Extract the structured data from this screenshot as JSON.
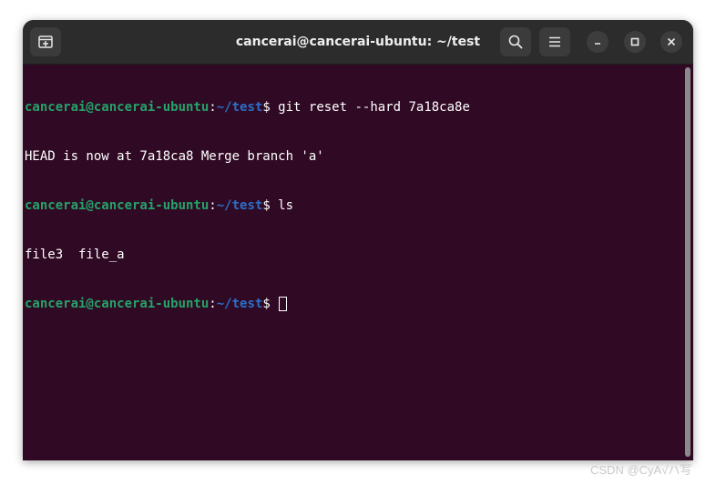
{
  "window": {
    "title": "cancerai@cancerai-ubuntu: ~/test"
  },
  "toolbar": {
    "new_tab_icon": "new-tab-icon",
    "search_icon": "search-icon",
    "menu_icon": "hamburger-menu-icon",
    "minimize_icon": "minimize-icon",
    "maximize_icon": "maximize-icon",
    "close_icon": "close-icon"
  },
  "terminal": {
    "prompt_user": "cancerai@cancerai-ubuntu",
    "prompt_sep": ":",
    "prompt_path": "~/test",
    "prompt_symbol": "$ ",
    "lines": [
      {
        "type": "prompt",
        "command": "git reset --hard 7a18ca8e"
      },
      {
        "type": "output",
        "text": "HEAD is now at 7a18ca8 Merge branch 'a'"
      },
      {
        "type": "prompt",
        "command": "ls"
      },
      {
        "type": "output",
        "text": "file3  file_a"
      },
      {
        "type": "prompt",
        "command": ""
      }
    ]
  },
  "colors": {
    "background": "#300a24",
    "titlebar": "#2c2c2c",
    "user": "#26a269",
    "path": "#2a6fc9",
    "text": "#ffffff"
  },
  "watermark": "CSDN @CyA√ハ写"
}
